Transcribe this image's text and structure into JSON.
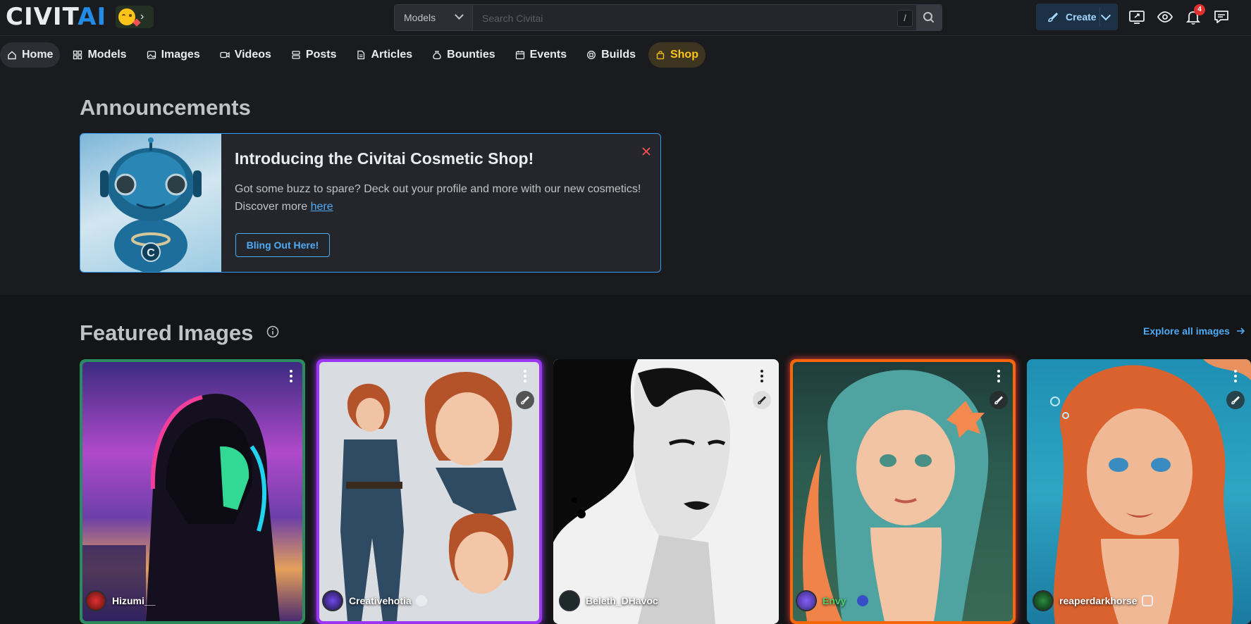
{
  "header": {
    "logo": {
      "civit": "CIVIT",
      "ai": "AI"
    },
    "search": {
      "type_label": "Models",
      "placeholder": "Search Civitai",
      "shortcut": "/"
    },
    "create_label": "Create",
    "notification_count": "4"
  },
  "nav": [
    {
      "label": "Home",
      "icon": "home-icon",
      "active": true
    },
    {
      "label": "Models",
      "icon": "grid-icon"
    },
    {
      "label": "Images",
      "icon": "photo-icon"
    },
    {
      "label": "Videos",
      "icon": "video-icon"
    },
    {
      "label": "Posts",
      "icon": "layers-icon"
    },
    {
      "label": "Articles",
      "icon": "file-text-icon"
    },
    {
      "label": "Bounties",
      "icon": "moneybag-icon"
    },
    {
      "label": "Events",
      "icon": "calendar-icon"
    },
    {
      "label": "Builds",
      "icon": "cpu-icon"
    },
    {
      "label": "Shop",
      "icon": "shopping-bag-icon"
    }
  ],
  "announcements": {
    "title": "Announcements",
    "card": {
      "heading": "Introducing the Civitai Cosmetic Shop!",
      "body": "Got some buzz to spare? Deck out your profile and more with our new cosmetics! Discover more",
      "link": "here",
      "button": "Bling Out Here!"
    }
  },
  "featured": {
    "title": "Featured Images",
    "explore_label": "Explore all images",
    "cards": [
      {
        "user": "Hizumi__",
        "frame": "#2f9e44"
      },
      {
        "user": "Creativehotia",
        "frame": "#9c36f5"
      },
      {
        "user": "Beleth_DHavoc",
        "frame": "#e9ecef"
      },
      {
        "user": "Envy",
        "frame": "#f76707"
      },
      {
        "user": "reaperdarkhorse",
        "frame": "#1c7ed6"
      }
    ]
  },
  "colors": {
    "accent": "#228be6",
    "shop": "#fcc419",
    "background": "#1a1b1e"
  }
}
